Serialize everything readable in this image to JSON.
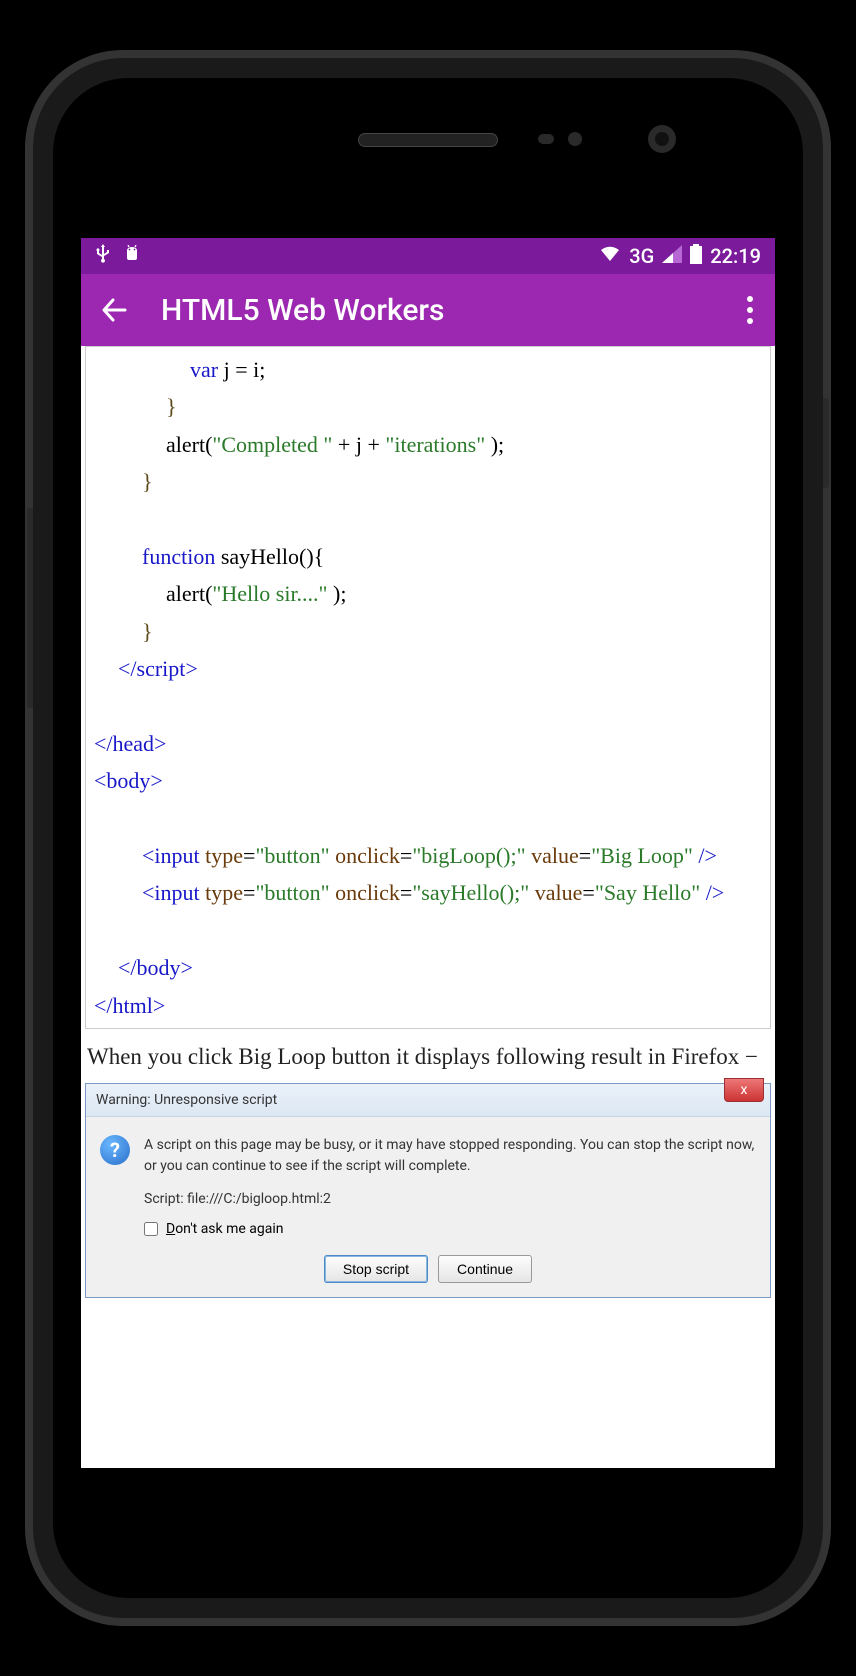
{
  "status": {
    "network": "3G",
    "time": "22:19"
  },
  "appbar": {
    "title": "HTML5 Web Workers"
  },
  "code_lines": {
    "l1a": "var",
    "l1b": " j = i;",
    "l2": "}",
    "l3a": "alert(",
    "l3b": "\"Completed \"",
    "l3c": " + j + ",
    "l3d": "\"iterations\"",
    "l3e": " );",
    "l4": "}",
    "l6a": "function",
    "l6b": " sayHello(){",
    "l7a": "alert(",
    "l7b": "\"Hello sir....\"",
    "l7c": " );",
    "l8": "}",
    "l9": "</script>",
    "l11": "</head>",
    "l12": "<body>",
    "l14a": "<input ",
    "l14b": "type",
    "l14c": "=",
    "l14d": "\"button\"",
    "l14e": " onclick",
    "l14f": "=",
    "l14g": "\"bigLoop();\"",
    "l14h": " value",
    "l14i": "=",
    "l14j": "\"Big Loop\"",
    "l14k": " />",
    "l15a": "<input ",
    "l15b": "type",
    "l15c": "=",
    "l15d": "\"button\"",
    "l15e": " onclick",
    "l15f": "=",
    "l15g": "\"sayHello();\"",
    "l15h": " value",
    "l15i": "=",
    "l15j": "\"Say Hello\"",
    "l15k": " />",
    "l17": "</body>",
    "l18": "</html>"
  },
  "body_text": "When you click Big Loop button it displays following result in Firefox −",
  "dialog": {
    "title": "Warning: Unresponsive script",
    "close": "x",
    "icon": "?",
    "message": "A script on this page may be busy, or it may have stopped responding. You can stop the script now, or you can continue to see if the script will complete.",
    "script_line": "Script: file:///C:/bigloop.html:2",
    "checkbox_label": "Don't ask me again",
    "btn_stop": "Stop script",
    "btn_continue": "Continue"
  }
}
